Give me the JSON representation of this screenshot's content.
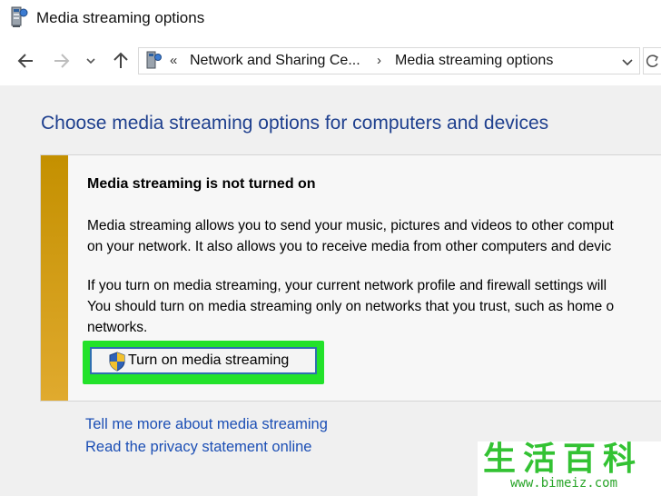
{
  "window": {
    "title": "Media streaming options",
    "icon": "network-folder-icon"
  },
  "navigation": {
    "back_icon": "arrow-left-icon",
    "forward_icon": "arrow-right-icon",
    "recent_icon": "chevron-down-icon",
    "up_icon": "arrow-up-icon"
  },
  "address_bar": {
    "overflow": "«",
    "breadcrumbs": [
      {
        "label": "Network and Sharing Ce..."
      },
      {
        "label": "Media streaming options"
      }
    ],
    "separator": "›"
  },
  "page": {
    "title": "Choose media streaming options for computers and devices"
  },
  "notice": {
    "heading": "Media streaming is not turned on",
    "paragraph1_line1": "Media streaming allows you to send your music, pictures and videos to other comput",
    "paragraph1_line2": "on your network.  It also allows you to receive media from other computers and devic",
    "paragraph2_line1": "If you turn on media streaming, your current network profile and firewall settings will",
    "paragraph2_line2": "You should turn on media streaming only on networks that you trust, such as home o",
    "paragraph2_line3": "networks.",
    "button_label": "Turn on media streaming",
    "stripe_color": "#c49000",
    "highlight_color": "#22e22a"
  },
  "links": [
    {
      "label": "Tell me more about media streaming"
    },
    {
      "label": "Read the privacy statement online"
    }
  ],
  "watermark": {
    "title": "生活百科",
    "url": "www.bimeiz.com"
  }
}
